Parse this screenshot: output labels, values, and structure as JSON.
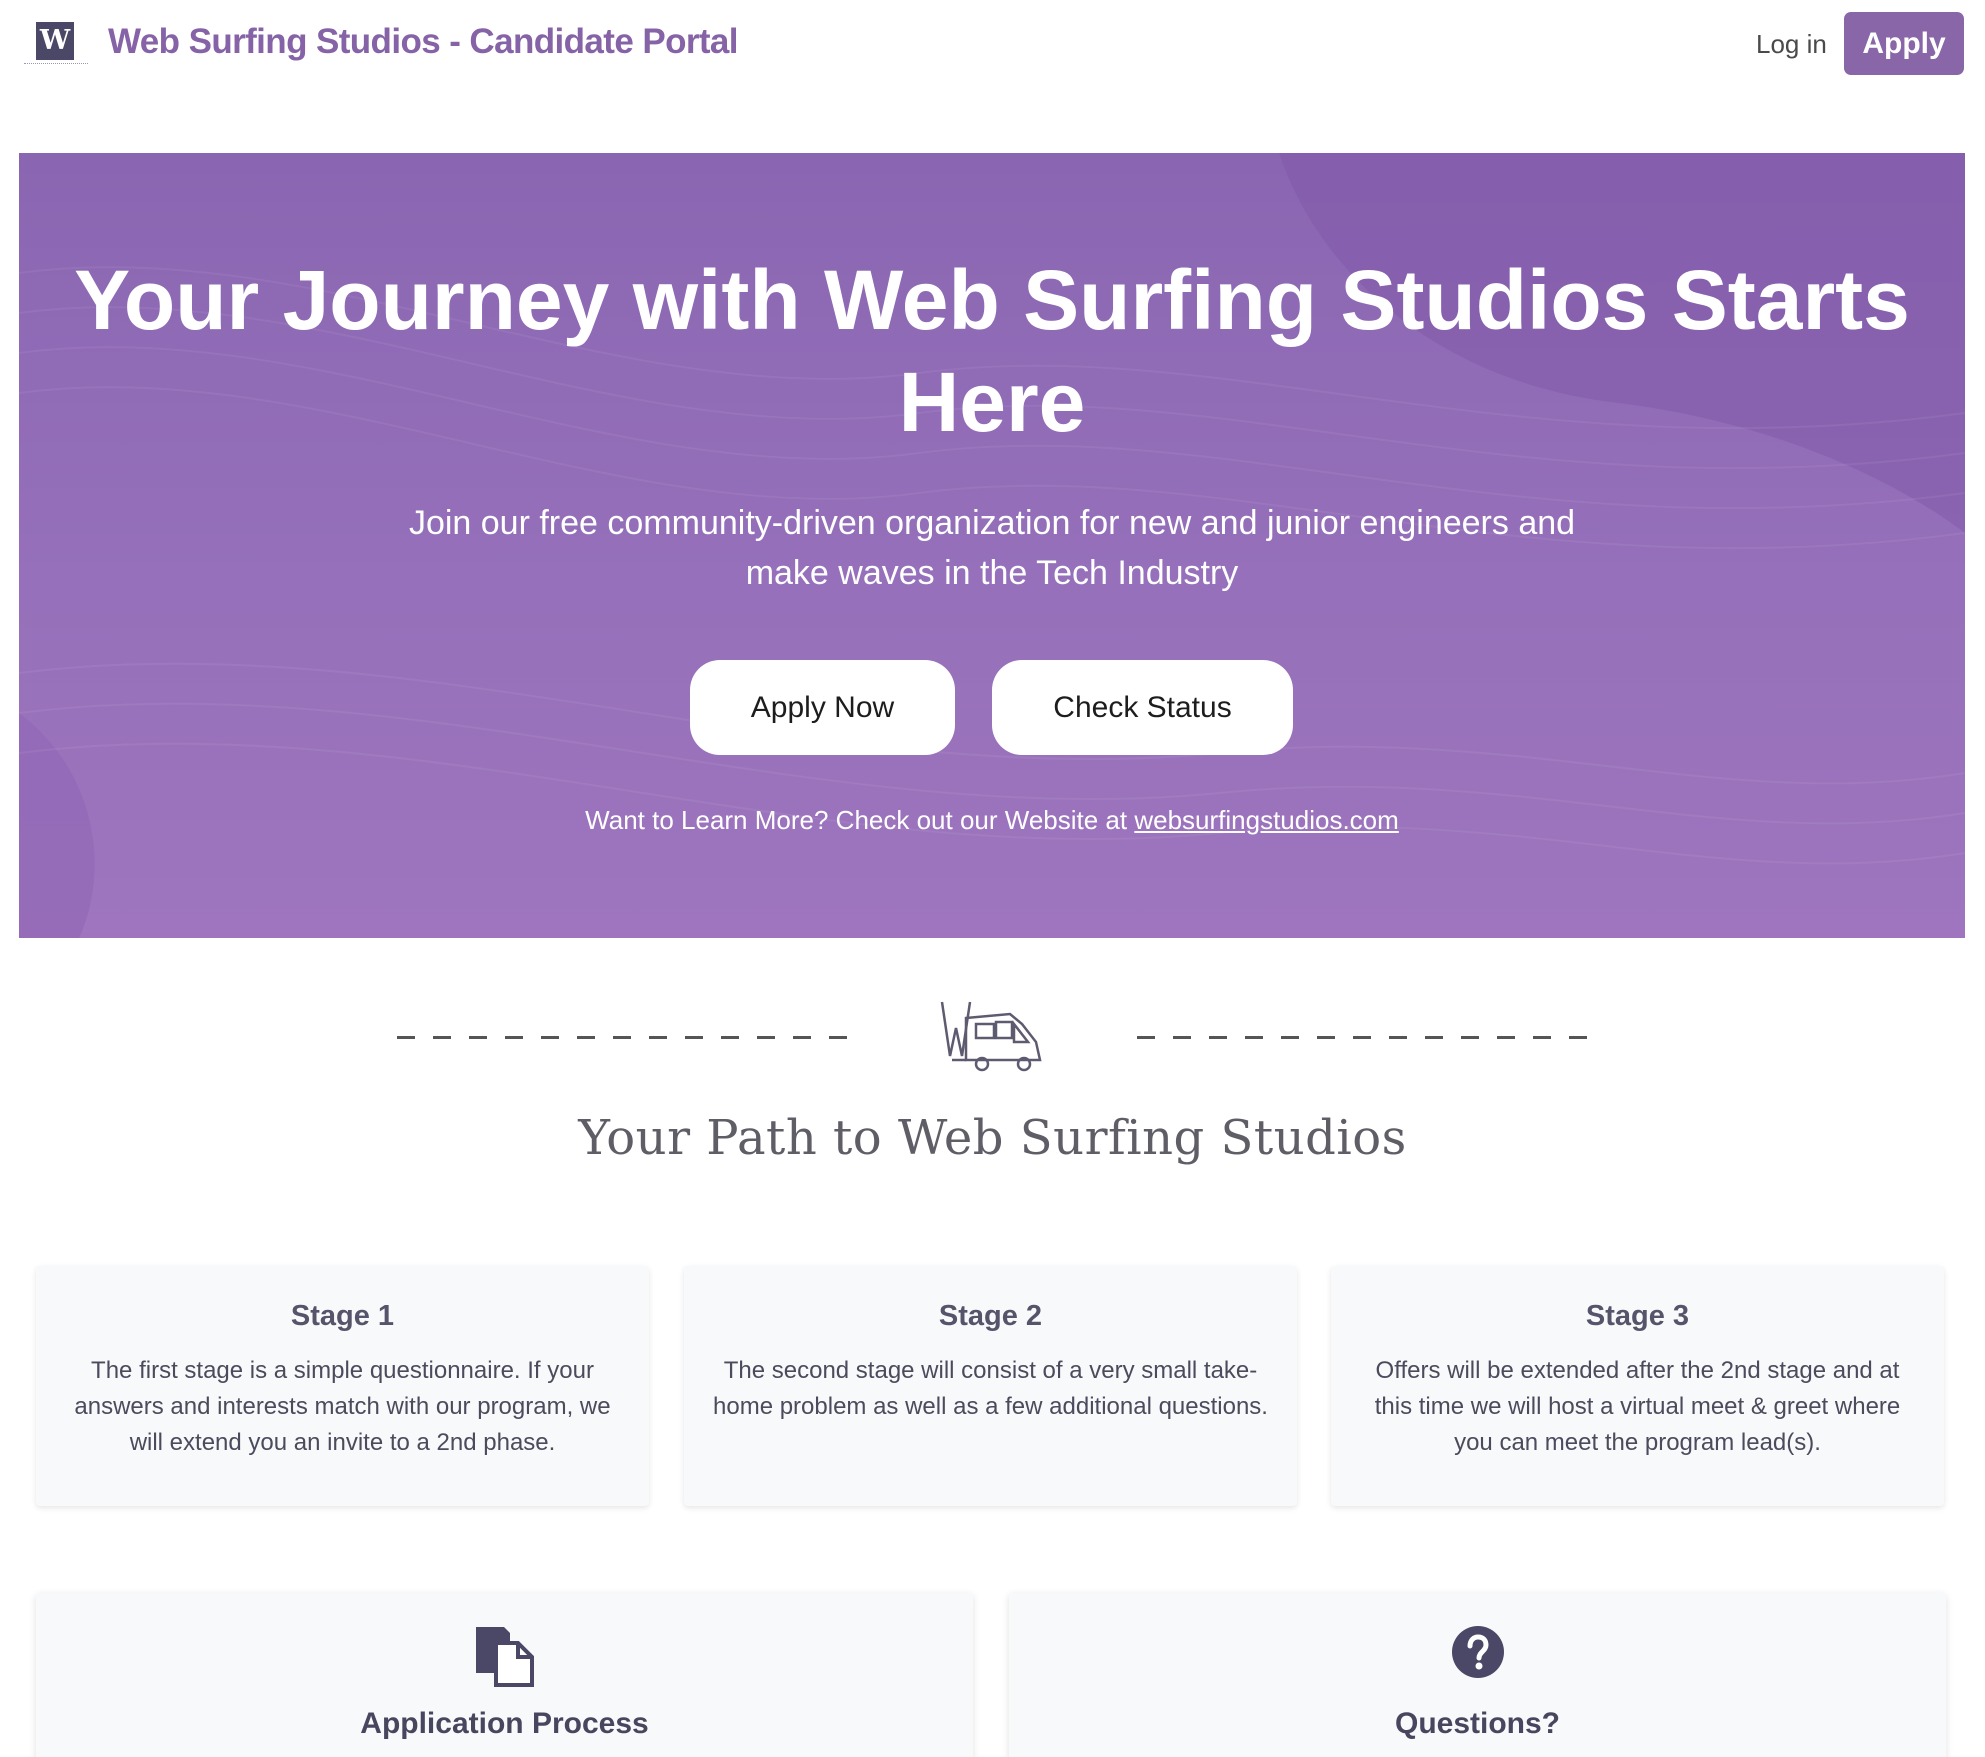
{
  "header": {
    "logo_letter": "W",
    "brand": "Web Surfing Studios - Candidate Portal",
    "login_label": "Log in",
    "apply_label": "Apply"
  },
  "hero": {
    "title": "Your Journey with Web Surfing Studios Starts Here",
    "subtitle": "Join our free community-driven organization for new and junior engineers and make waves in the Tech Industry",
    "apply_now_label": "Apply Now",
    "check_status_label": "Check Status",
    "learn_more_text": "Want to Learn More? Check out our Website at ",
    "website_link": "websurfingstudios.com"
  },
  "path": {
    "title": "Your Path to Web Surfing Studios",
    "divider_icon": "van-icon"
  },
  "stages": [
    {
      "title": "Stage 1",
      "text": "The first stage is a simple questionnaire. If your answers and interests match with our program, we will extend you an invite to a 2nd phase."
    },
    {
      "title": "Stage 2",
      "text": "The second stage will consist of a very small take-home problem as well as a few additional questions."
    },
    {
      "title": "Stage 3",
      "text": "Offers will be extended after the 2nd stage and at this time we will host a virtual meet & greet where you can meet the program lead(s)."
    }
  ],
  "info_cards": [
    {
      "title": "Application Process",
      "icon": "document-copy-icon"
    },
    {
      "title": "Questions?",
      "icon": "question-circle-icon"
    }
  ],
  "colors": {
    "brand": "#8563a6",
    "apply_button": "#8866a8",
    "hero_top": "#8a66b2",
    "hero_bottom": "#9e75be",
    "icon_dark": "#4a4767",
    "card_bg": "#f8f9fa"
  }
}
